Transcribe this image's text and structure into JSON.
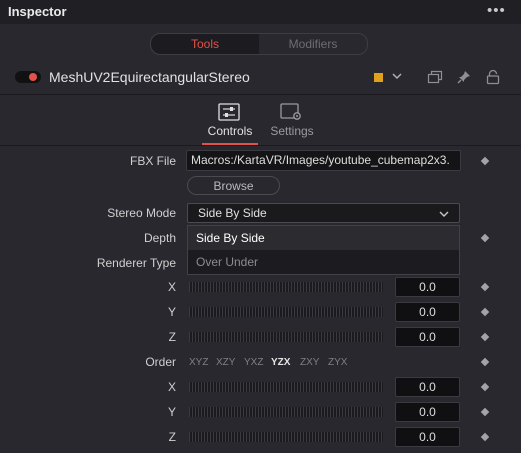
{
  "window": {
    "title": "Inspector",
    "more_glyph": "•••"
  },
  "view_toggle": {
    "tools": "Tools",
    "modifiers": "Modifiers",
    "active": "Tools"
  },
  "node": {
    "name": "MeshUV2EquirectangularStereo",
    "color": "#e0a21d"
  },
  "tabs": [
    {
      "label": "Controls",
      "icon": "sliders-icon",
      "active": true
    },
    {
      "label": "Settings",
      "icon": "settings-icon",
      "active": false
    }
  ],
  "fbx": {
    "label": "FBX File",
    "value": "Macros:/KartaVR/Images/youtube_cubemap2x3.",
    "browse": "Browse"
  },
  "stereo": {
    "label": "Stereo Mode",
    "value": "Side By Side",
    "options": [
      "Side By Side",
      "Over Under"
    ],
    "highlighted": "Side By Side"
  },
  "depth": {
    "label": "Depth"
  },
  "renderer": {
    "label": "Renderer Type"
  },
  "rotation1": {
    "x": {
      "label": "X",
      "value": "0.0"
    },
    "y": {
      "label": "Y",
      "value": "0.0"
    },
    "z": {
      "label": "Z",
      "value": "0.0"
    }
  },
  "order": {
    "label": "Order",
    "options": [
      "XYZ",
      "XZY",
      "YXZ",
      "YZX",
      "ZXY",
      "ZYX"
    ],
    "selected": "YZX"
  },
  "rotation2": {
    "x": {
      "label": "X",
      "value": "0.0"
    },
    "y": {
      "label": "Y",
      "value": "0.0"
    },
    "z": {
      "label": "Z",
      "value": "0.0"
    }
  },
  "colors": {
    "accent": "#e2514b",
    "background": "#28282e"
  }
}
